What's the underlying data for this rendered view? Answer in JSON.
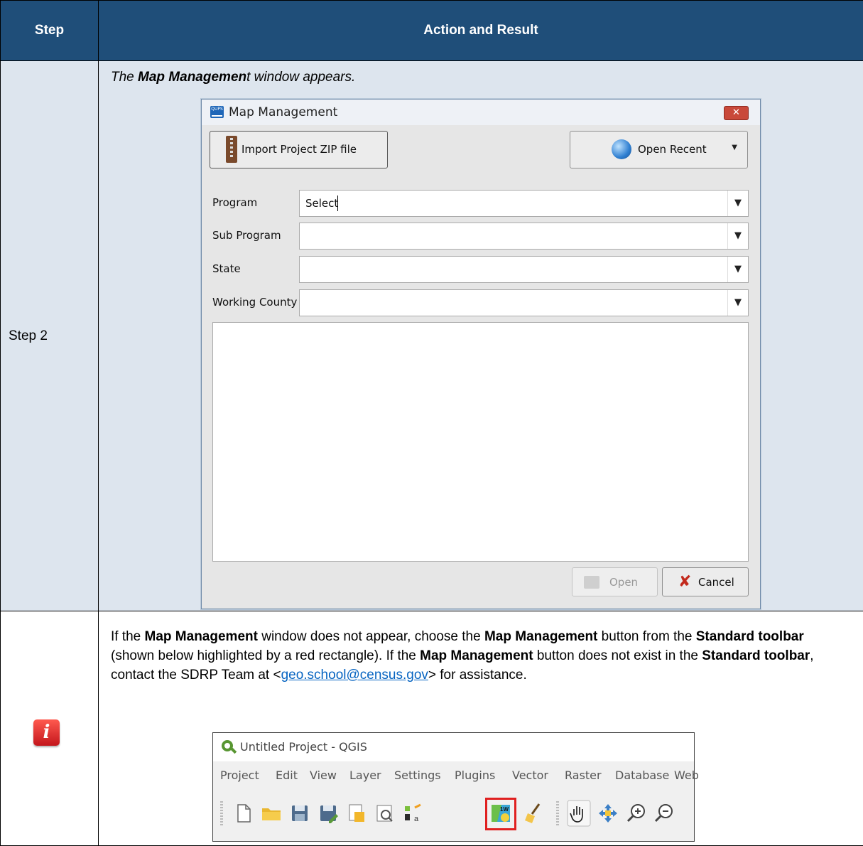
{
  "table": {
    "header_step": "Step",
    "header_action": "Action and Result",
    "step_label": "Step 2",
    "intro_pre": "The ",
    "intro_bold": "Map Managemen",
    "intro_post": "t window appears."
  },
  "dialog": {
    "title": "Map Management",
    "app_icon_text": "QUPS",
    "close_glyph": "✕",
    "import_label": "Import Project ZIP file",
    "recent_label": "Open Recent",
    "fields": [
      {
        "label": "Program",
        "value": "Select"
      },
      {
        "label": "Sub Program",
        "value": ""
      },
      {
        "label": "State",
        "value": ""
      },
      {
        "label": "Working County",
        "value": ""
      }
    ],
    "open_label": "Open",
    "cancel_label": "Cancel"
  },
  "info": {
    "t1": "If the ",
    "b1": "Map Management",
    "t2": " window does not appear, choose the ",
    "b2": "Map Management",
    "t3": " button from the ",
    "b3": "Standard toolbar",
    "t4": " (shown below highlighted by a red rectangle). If the ",
    "b4": "Map Management",
    "t5": " button does not exist in the ",
    "b5": "Standard toolbar",
    "t6": ", contact the SDRP Team at <",
    "email": "geo.school@census.gov",
    "t7": "> for assistance.",
    "icon_letter": "i"
  },
  "qgis": {
    "title": "Untitled Project - QGIS",
    "menus": [
      "Project",
      "Edit",
      "View",
      "Layer",
      "Settings",
      "Plugins",
      "Vector",
      "Raster",
      "Database",
      "Web"
    ],
    "map_btn_text": "1W"
  },
  "colors": {
    "header_bg": "#1f4e79",
    "row_bg": "#dde5ee",
    "highlight": "#e02020",
    "link": "#0563c1"
  }
}
